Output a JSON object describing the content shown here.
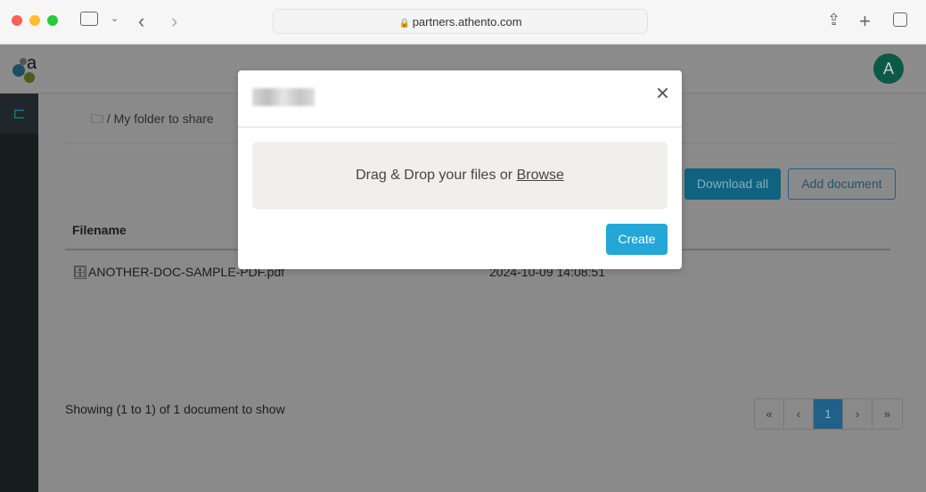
{
  "browser": {
    "url": "partners.athento.com"
  },
  "header": {
    "avatar_initial": "A"
  },
  "breadcrumb": {
    "folder": "My folder to share",
    "separator": "/"
  },
  "toolbar": {
    "download_all": "Download all",
    "add_document": "Add document"
  },
  "table": {
    "columns": [
      "Filename"
    ],
    "rows": [
      {
        "filename": "ANOTHER-DOC-SAMPLE-PDF.pdf",
        "date": "2024-10-09 14:08:51"
      }
    ]
  },
  "footer": {
    "showing": "Showing (1 to 1) of 1 document to show"
  },
  "pagination": {
    "first": "«",
    "prev": "‹",
    "current": "1",
    "next": "›",
    "last": "»"
  },
  "modal": {
    "drop_text": "Drag & Drop your files or ",
    "browse": "Browse",
    "create": "Create",
    "close": "×"
  },
  "colors": {
    "accent": "#22a7d8",
    "sidebar": "#171c1f",
    "avatar": "#0b5a48"
  }
}
